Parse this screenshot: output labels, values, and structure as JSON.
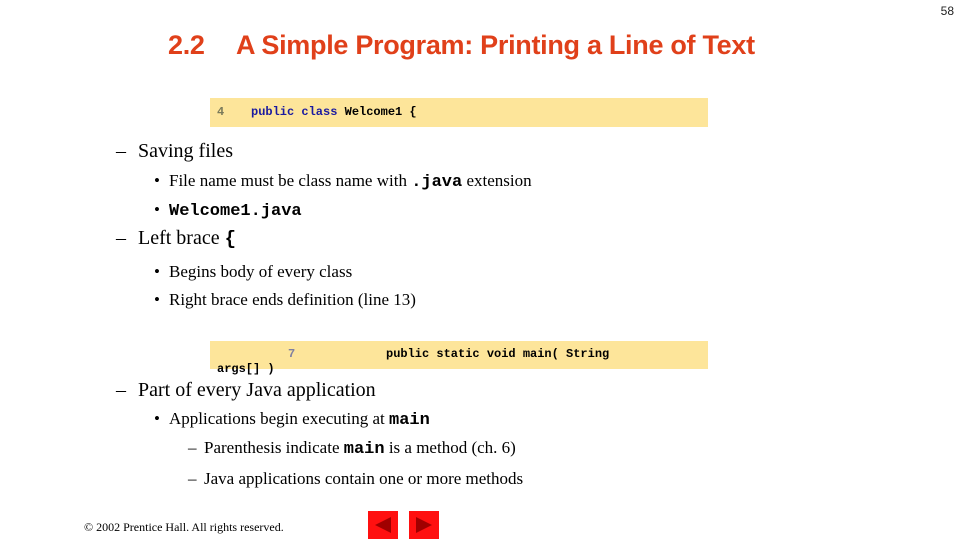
{
  "page_number": "58",
  "title": {
    "number": "2.2",
    "text": "A Simple Program: Printing a Line of Text"
  },
  "code_line_4": {
    "line_number": "4",
    "keywords": "public class",
    "rest": " Welcome1 {"
  },
  "saving_files": {
    "heading": "Saving files",
    "items": [
      {
        "before": "File name must be class name with ",
        "code": ".java",
        "after": " extension"
      },
      {
        "code": "Welcome1.java"
      }
    ]
  },
  "left_brace": {
    "heading": "Left brace ",
    "code": "{",
    "items": [
      "Begins body of every class",
      "Right brace ends definition (line 13)"
    ]
  },
  "code_line_7": {
    "line_number": "7",
    "text": "public static void main( String",
    "wrap": "args[] )"
  },
  "java_app": {
    "heading": "Part of every Java application",
    "item": {
      "before": "Applications begin executing at ",
      "code": "main"
    },
    "subitems": [
      {
        "before": "Parenthesis indicate ",
        "code": "main",
        "after": " is a method (ch. 6)"
      },
      {
        "before": "Java applications contain one or more methods",
        "code": "",
        "after": ""
      }
    ]
  },
  "footer": {
    "copyright": "© 2002 Prentice Hall.  All rights reserved."
  },
  "nav": {
    "prev_icon": "triangle-left",
    "next_icon": "triangle-right"
  }
}
